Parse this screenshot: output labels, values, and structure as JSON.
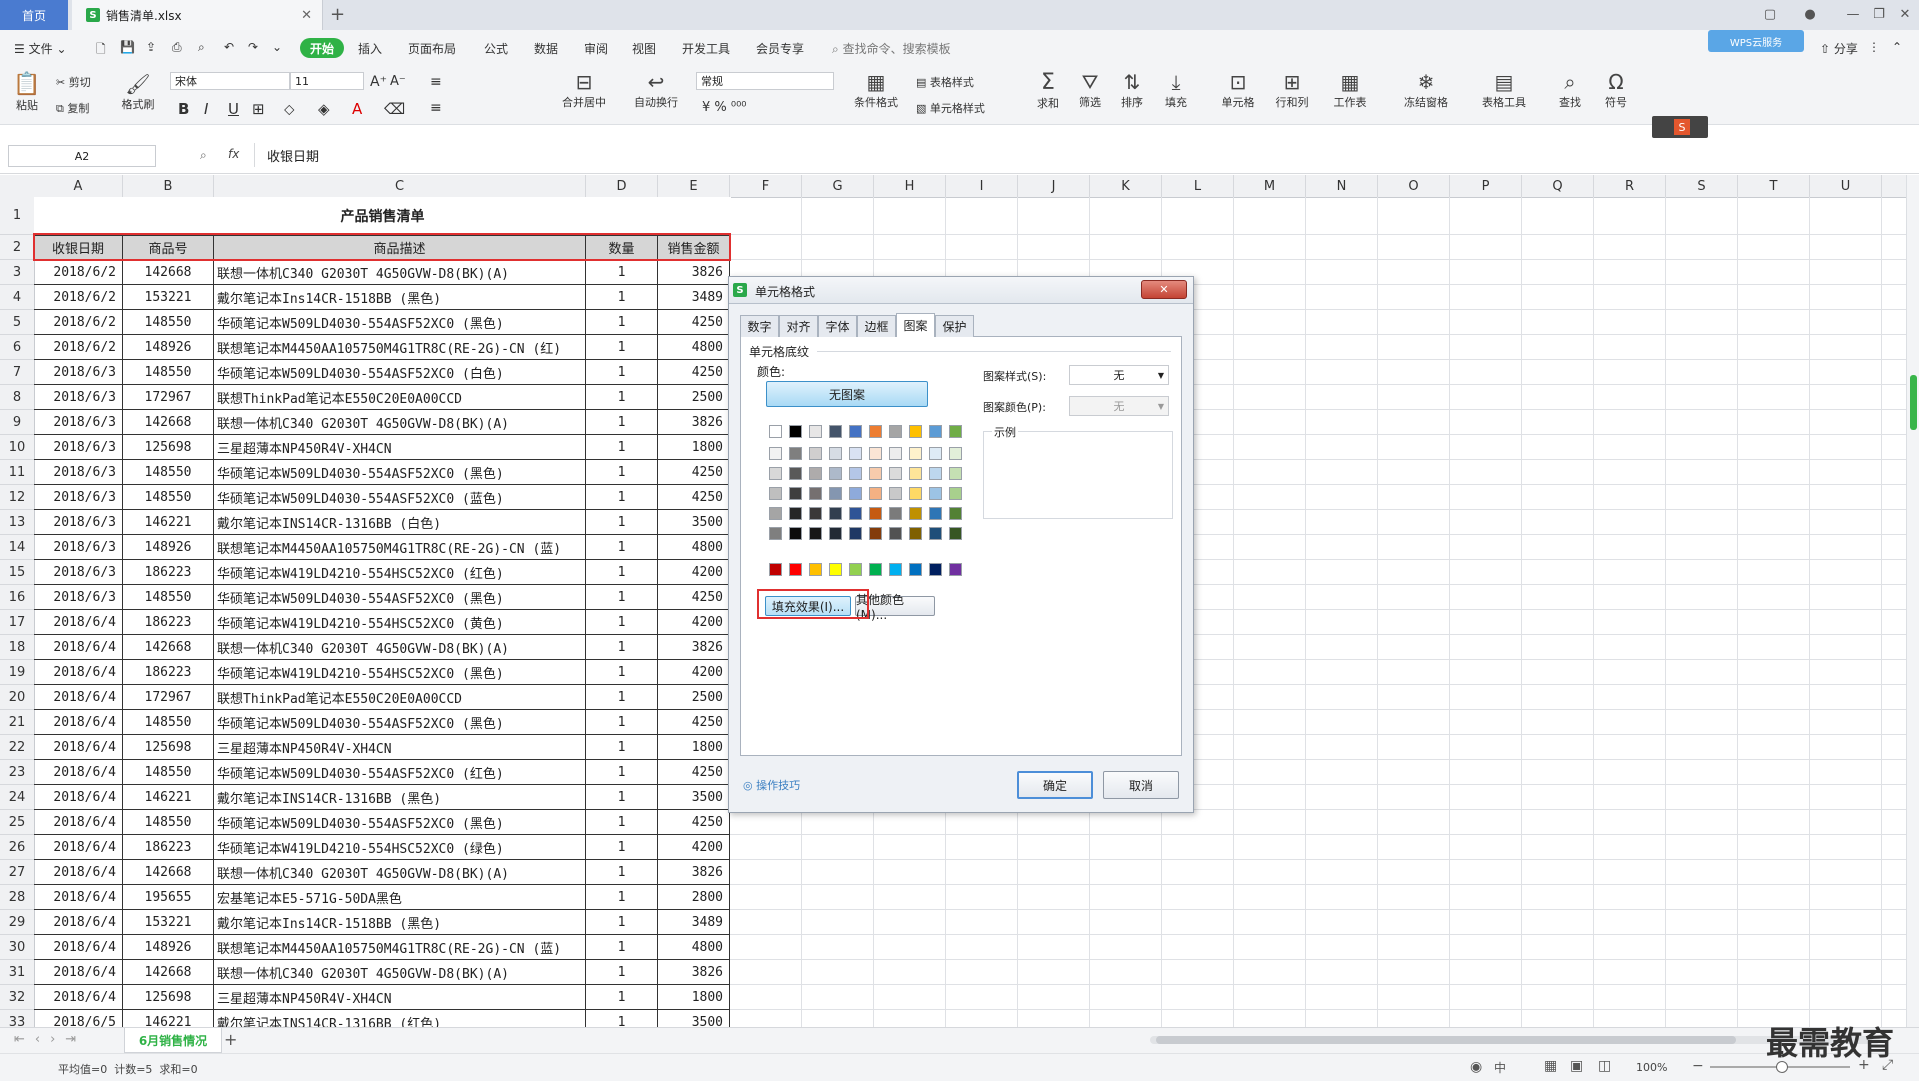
{
  "titlebar": {
    "home_tab": "首页",
    "file_tab": "销售清单.xlsx",
    "file_tab_close": "✕",
    "add_tab": "+"
  },
  "menubar": {
    "file_menu": "文件",
    "start": "开始",
    "items": [
      "插入",
      "页面布局",
      "公式",
      "数据",
      "审阅",
      "视图",
      "开发工具",
      "会员专享"
    ],
    "search_placeholder": "查找命令、搜索模板",
    "share": "分享",
    "cloud_badge": "WPS云服务"
  },
  "ribbon": {
    "paste": "粘贴",
    "cut": "剪切",
    "copy": "复制",
    "format_painter": "格式刷",
    "font_name": "宋体",
    "font_size": "11",
    "merge_center": "合并居中",
    "auto_wrap": "自动换行",
    "number_format": "常规",
    "cond_format": "条件格式",
    "table_style": "表格样式",
    "cell_style": "单元格样式",
    "sum": "求和",
    "filter": "筛选",
    "sort": "排序",
    "fill": "填充",
    "cell": "单元格",
    "row_col": "行和列",
    "worksheet": "工作表",
    "freeze": "冻结窗格",
    "table_tools": "表格工具",
    "find": "查找",
    "symbol": "符号"
  },
  "formula_bar": {
    "name_box": "A2",
    "fx": "fx",
    "content": "收银日期"
  },
  "columns": [
    "A",
    "B",
    "C",
    "D",
    "E",
    "F",
    "G",
    "H",
    "I",
    "J",
    "K",
    "L",
    "M",
    "N",
    "O",
    "P",
    "Q",
    "R",
    "S",
    "T",
    "U"
  ],
  "sheet": {
    "title": "产品销售清单",
    "headers": [
      "收银日期",
      "商品号",
      "商品描述",
      "数量",
      "销售金额"
    ],
    "rows": [
      [
        "2018/6/2",
        "142668",
        "联想一体机C340 G2030T 4G50GVW-D8(BK)(A)",
        "1",
        "3826"
      ],
      [
        "2018/6/2",
        "153221",
        "戴尔笔记本Ins14CR-1518BB (黑色)",
        "1",
        "3489"
      ],
      [
        "2018/6/2",
        "148550",
        "华硕笔记本W509LD4030-554ASF52XC0 (黑色)",
        "1",
        "4250"
      ],
      [
        "2018/6/2",
        "148926",
        "联想笔记本M4450AA105750M4G1TR8C(RE-2G)-CN (红)",
        "1",
        "4800"
      ],
      [
        "2018/6/3",
        "148550",
        "华硕笔记本W509LD4030-554ASF52XC0 (白色)",
        "1",
        "4250"
      ],
      [
        "2018/6/3",
        "172967",
        "联想ThinkPad笔记本E550C20E0A00CCD",
        "1",
        "2500"
      ],
      [
        "2018/6/3",
        "142668",
        "联想一体机C340 G2030T 4G50GVW-D8(BK)(A)",
        "1",
        "3826"
      ],
      [
        "2018/6/3",
        "125698",
        "三星超薄本NP450R4V-XH4CN",
        "1",
        "1800"
      ],
      [
        "2018/6/3",
        "148550",
        "华硕笔记本W509LD4030-554ASF52XC0 (黑色)",
        "1",
        "4250"
      ],
      [
        "2018/6/3",
        "148550",
        "华硕笔记本W509LD4030-554ASF52XC0 (蓝色)",
        "1",
        "4250"
      ],
      [
        "2018/6/3",
        "146221",
        "戴尔笔记本INS14CR-1316BB (白色)",
        "1",
        "3500"
      ],
      [
        "2018/6/3",
        "148926",
        "联想笔记本M4450AA105750M4G1TR8C(RE-2G)-CN (蓝)",
        "1",
        "4800"
      ],
      [
        "2018/6/3",
        "186223",
        "华硕笔记本W419LD4210-554HSC52XC0 (红色)",
        "1",
        "4200"
      ],
      [
        "2018/6/3",
        "148550",
        "华硕笔记本W509LD4030-554ASF52XC0 (黑色)",
        "1",
        "4250"
      ],
      [
        "2018/6/4",
        "186223",
        "华硕笔记本W419LD4210-554HSC52XC0 (黄色)",
        "1",
        "4200"
      ],
      [
        "2018/6/4",
        "142668",
        "联想一体机C340 G2030T 4G50GVW-D8(BK)(A)",
        "1",
        "3826"
      ],
      [
        "2018/6/4",
        "186223",
        "华硕笔记本W419LD4210-554HSC52XC0 (黑色)",
        "1",
        "4200"
      ],
      [
        "2018/6/4",
        "172967",
        "联想ThinkPad笔记本E550C20E0A00CCD",
        "1",
        "2500"
      ],
      [
        "2018/6/4",
        "148550",
        "华硕笔记本W509LD4030-554ASF52XC0 (黑色)",
        "1",
        "4250"
      ],
      [
        "2018/6/4",
        "125698",
        "三星超薄本NP450R4V-XH4CN",
        "1",
        "1800"
      ],
      [
        "2018/6/4",
        "148550",
        "华硕笔记本W509LD4030-554ASF52XC0 (红色)",
        "1",
        "4250"
      ],
      [
        "2018/6/4",
        "146221",
        "戴尔笔记本INS14CR-1316BB (黑色)",
        "1",
        "3500"
      ],
      [
        "2018/6/4",
        "148550",
        "华硕笔记本W509LD4030-554ASF52XC0 (黑色)",
        "1",
        "4250"
      ],
      [
        "2018/6/4",
        "186223",
        "华硕笔记本W419LD4210-554HSC52XC0 (绿色)",
        "1",
        "4200"
      ],
      [
        "2018/6/4",
        "142668",
        "联想一体机C340 G2030T 4G50GVW-D8(BK)(A)",
        "1",
        "3826"
      ],
      [
        "2018/6/4",
        "195655",
        "宏基笔记本E5-571G-50DA黑色",
        "1",
        "2800"
      ],
      [
        "2018/6/4",
        "153221",
        "戴尔笔记本Ins14CR-1518BB (黑色)",
        "1",
        "3489"
      ],
      [
        "2018/6/4",
        "148926",
        "联想笔记本M4450AA105750M4G1TR8C(RE-2G)-CN (蓝)",
        "1",
        "4800"
      ],
      [
        "2018/6/4",
        "142668",
        "联想一体机C340 G2030T 4G50GVW-D8(BK)(A)",
        "1",
        "3826"
      ],
      [
        "2018/6/4",
        "125698",
        "三星超薄本NP450R4V-XH4CN",
        "1",
        "1800"
      ],
      [
        "2018/6/5",
        "146221",
        "戴尔笔记本INS14CR-1316BB (红色)",
        "1",
        "3500"
      ]
    ]
  },
  "dialog": {
    "title": "单元格格式",
    "tabs": [
      "数字",
      "对齐",
      "字体",
      "边框",
      "图案",
      "保护"
    ],
    "active_tab": "图案",
    "section": "单元格底纹",
    "color_label": "颜色:",
    "no_pattern": "无图案",
    "pattern_style_label": "图案样式(S):",
    "pattern_style_value": "无",
    "pattern_color_label": "图案颜色(P):",
    "pattern_color_value": "无",
    "sample_label": "示例",
    "fill_effects": "填充效果(I)...",
    "other_colors": "其他颜色(M)...",
    "tips": "操作技巧",
    "ok": "确定",
    "cancel": "取消",
    "palette_top": [
      "#ffffff",
      "#000000",
      "#e7e6e6",
      "#44546a",
      "#4472c4",
      "#ed7d31",
      "#a5a5a5",
      "#ffc000",
      "#5b9bd5",
      "#70ad47"
    ],
    "palette_tints": [
      [
        "#f2f2f2",
        "#7f7f7f",
        "#d0cece",
        "#d6dce4",
        "#d9e2f3",
        "#fbe5d5",
        "#ededed",
        "#fff2cc",
        "#deebf6",
        "#e2efd9"
      ],
      [
        "#d8d8d8",
        "#595959",
        "#aeabab",
        "#adb9ca",
        "#b4c6e7",
        "#f7cbac",
        "#dbdbdb",
        "#fee599",
        "#bdd7ee",
        "#c5e0b3"
      ],
      [
        "#bfbfbf",
        "#3f3f3f",
        "#757070",
        "#8496b0",
        "#8eaadb",
        "#f4b183",
        "#c9c9c9",
        "#ffd965",
        "#9cc3e5",
        "#a8d08d"
      ],
      [
        "#a5a5a5",
        "#262626",
        "#3a3838",
        "#323f4f",
        "#2f5496",
        "#c55a11",
        "#7b7b7b",
        "#bf9000",
        "#2e75b5",
        "#538135"
      ],
      [
        "#7f7f7f",
        "#0c0c0c",
        "#171616",
        "#222a35",
        "#1f3864",
        "#833c0b",
        "#525252",
        "#7f6000",
        "#1e4e79",
        "#375623"
      ]
    ],
    "palette_standard": [
      "#c00000",
      "#ff0000",
      "#ffc000",
      "#ffff00",
      "#92d050",
      "#00b050",
      "#00b0f0",
      "#0070c0",
      "#002060",
      "#7030a0"
    ]
  },
  "sheet_tabs": {
    "active": "6月销售情况",
    "add": "+"
  },
  "status": {
    "stats": "平均值=0  计数=5  求和=0",
    "zoom": "100%",
    "watermark": "最需教育"
  }
}
